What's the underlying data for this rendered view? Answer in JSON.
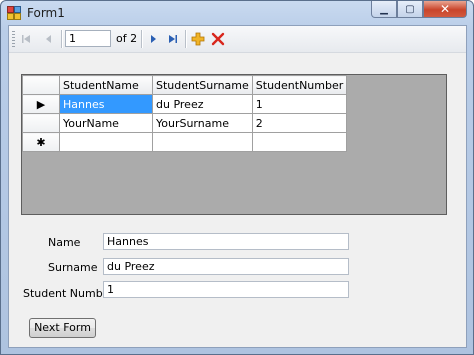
{
  "window": {
    "title": "Form1",
    "minimize_glyph": "▁",
    "maximize_glyph": "▢",
    "close_glyph": "✕"
  },
  "navigator": {
    "position": "1",
    "of_label": "of 2",
    "icons": [
      "move-first-icon",
      "move-previous-icon",
      "move-next-icon",
      "move-last-icon",
      "add-new-icon",
      "delete-icon"
    ]
  },
  "grid": {
    "columns": [
      "StudentName",
      "StudentSurname",
      "StudentNumber"
    ],
    "rows": [
      {
        "indicator": "▶",
        "cells": [
          "Hannes",
          "du Preez",
          "1"
        ]
      },
      {
        "indicator": "",
        "cells": [
          "YourName",
          "YourSurname",
          "2"
        ]
      },
      {
        "indicator": "✱",
        "cells": [
          "",
          "",
          ""
        ]
      }
    ]
  },
  "form": {
    "name_label": "Name",
    "name_value": "Hannes",
    "surname_label": "Surname",
    "surname_value": "du Preez",
    "number_label": "Student Number",
    "number_value": "1"
  },
  "next_button": "Next Form",
  "colors": {
    "selection": "#3399ff",
    "grid_background": "#ababab",
    "add_icon": "#e8a000",
    "delete_icon": "#d8261c",
    "nav_icon": "#2a5fb3"
  }
}
